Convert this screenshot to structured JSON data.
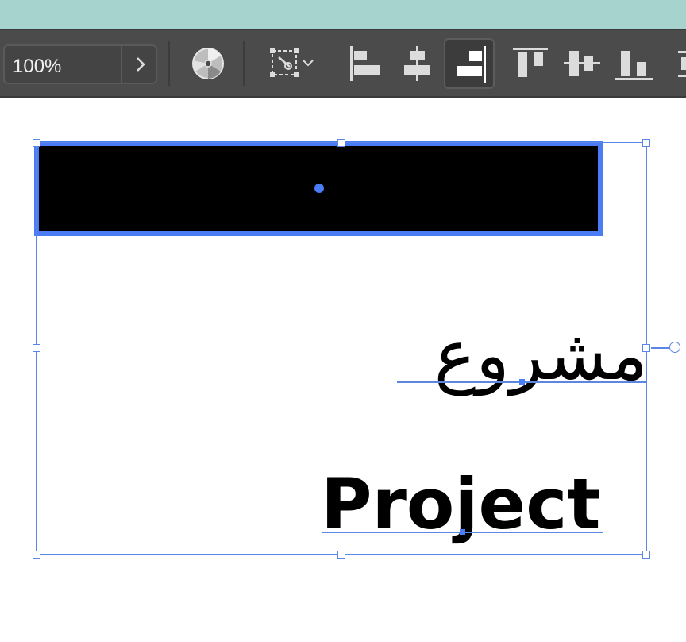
{
  "colors": {
    "top_strip": "#a7d3cf",
    "toolbar": "#4b4b4b",
    "selection": "#4a7cf6",
    "icon": "#dcdcdc"
  },
  "toolbar": {
    "zoom_value": "100%",
    "icons": [
      "chevron-right-icon",
      "color-wheel-icon",
      "transform-selection-icon",
      "align-left-icon",
      "align-horizontal-center-icon",
      "align-right-icon",
      "align-top-icon",
      "align-vertical-center-icon",
      "align-bottom-icon"
    ],
    "active_tool": "align-right"
  },
  "canvas": {
    "arabic_text": "مشروع",
    "english_text": "Project"
  }
}
